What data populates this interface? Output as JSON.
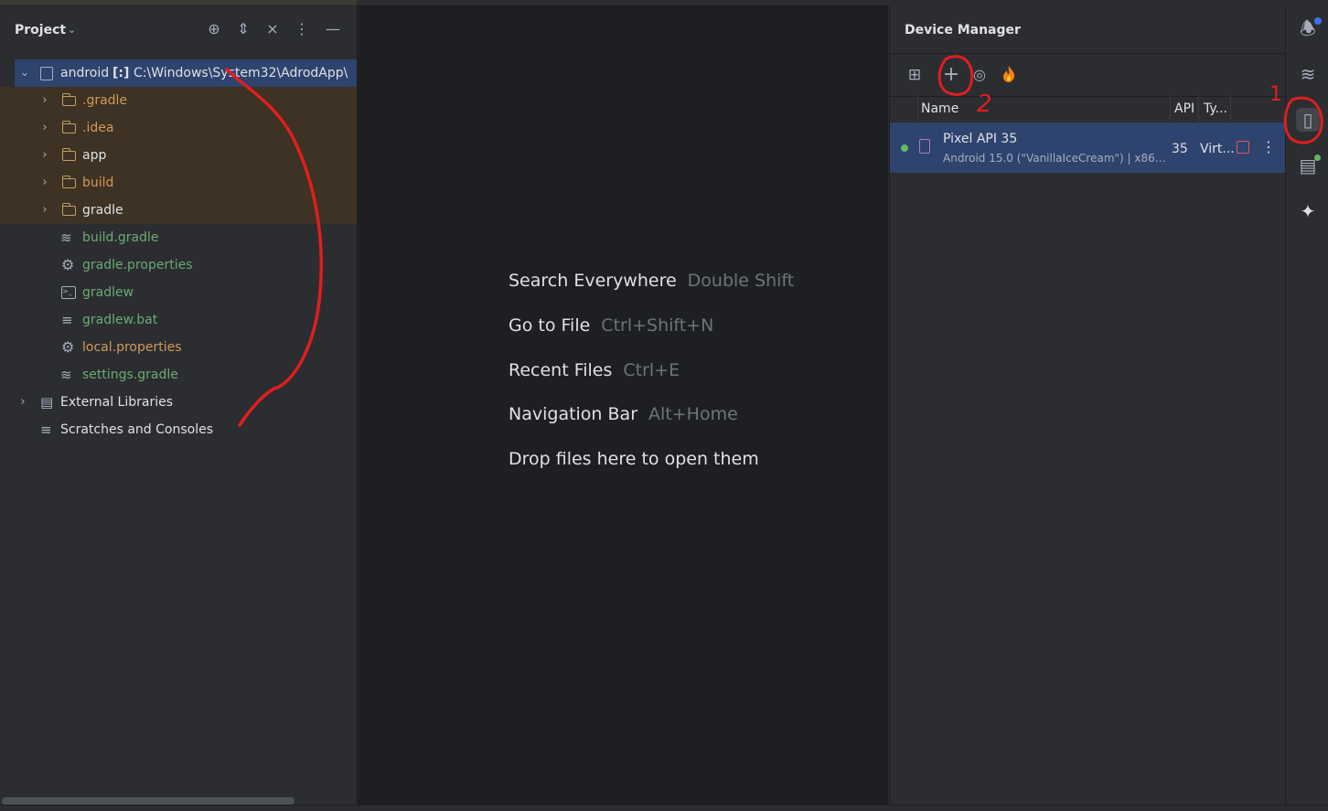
{
  "project": {
    "title": "Project",
    "root": {
      "name": "android",
      "marker": "[:]",
      "path": "C:\\Windows\\System32\\AdrodApp\\"
    },
    "folders": [
      ".gradle",
      ".idea",
      "app",
      "build",
      "gradle"
    ],
    "files": [
      {
        "name": "build.gradle",
        "icon": "gradle-icon"
      },
      {
        "name": "gradle.properties",
        "icon": "settings-gear-icon"
      },
      {
        "name": "gradlew",
        "icon": "terminal-icon"
      },
      {
        "name": "gradlew.bat",
        "icon": "text-lines-icon"
      },
      {
        "name": "local.properties",
        "icon": "settings-gear-icon"
      },
      {
        "name": "settings.gradle",
        "icon": "gradle-icon"
      }
    ],
    "external_libraries": "External Libraries",
    "scratches": "Scratches and Consoles"
  },
  "editor": {
    "hints": [
      {
        "label": "Search Everywhere",
        "shortcut": "Double Shift"
      },
      {
        "label": "Go to File",
        "shortcut": "Ctrl+Shift+N"
      },
      {
        "label": "Recent Files",
        "shortcut": "Ctrl+E"
      },
      {
        "label": "Navigation Bar",
        "shortcut": "Alt+Home"
      },
      {
        "label": "Drop files here to open them",
        "shortcut": ""
      }
    ]
  },
  "device_manager": {
    "title": "Device Manager",
    "columns": {
      "name": "Name",
      "api": "API",
      "type": "Ty..."
    },
    "device": {
      "name": "Pixel API 35",
      "subtitle": "Android 15.0 (\"VanillaIceCream\") | x86_...",
      "api": "35",
      "type": "Virt...",
      "status": "running"
    }
  },
  "annotations": {
    "one": "1",
    "two": "2"
  },
  "colors": {
    "accent_selection": "#2e436e",
    "annotation_red": "#e01e1e",
    "status_green": "#5fb865"
  }
}
